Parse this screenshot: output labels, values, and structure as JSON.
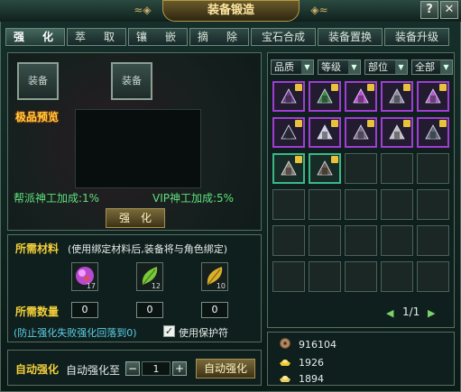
{
  "window": {
    "title": "装备锻造",
    "help_label": "?",
    "close_label": "✕"
  },
  "tabs": [
    {
      "label": "强　化",
      "active": true
    },
    {
      "label": "萃　取",
      "active": false
    },
    {
      "label": "镶　嵌",
      "active": false
    },
    {
      "label": "摘　除",
      "active": false
    },
    {
      "label": "宝石合成",
      "active": false
    },
    {
      "label": "装备置换",
      "active": false
    },
    {
      "label": "装备升级",
      "active": false
    }
  ],
  "enhance": {
    "slot_left_label": "装备",
    "slot_right_label": "装备",
    "preview_label": "极品预览",
    "guild_bonus": "帮派神工加成:1%",
    "vip_bonus": "VIP神工加成:5%",
    "enhance_button": "强　化"
  },
  "materials": {
    "title": "所需材料",
    "hint": "(使用绑定材料后,装备将与角色绑定)",
    "items": [
      {
        "icon": "purple-orb-icon",
        "count": "17",
        "color": "#c04ad8"
      },
      {
        "icon": "green-leaf-icon",
        "count": "12",
        "color": "#7ac83a"
      },
      {
        "icon": "gold-leaf-icon",
        "count": "10",
        "color": "#d8b02a"
      }
    ],
    "quantity_label": "所需数量",
    "quantities": [
      "0",
      "0",
      "0"
    ],
    "protect_hint": "(防止强化失败强化回落到0)",
    "protect_checked": true,
    "protect_label": "使用保护符"
  },
  "auto": {
    "title": "自动强化",
    "target_label": "自动强化至",
    "minus": "−",
    "value": "1",
    "plus": "+",
    "button": "自动强化"
  },
  "filters": [
    {
      "label": "品质"
    },
    {
      "label": "等级"
    },
    {
      "label": "部位"
    },
    {
      "label": "全部"
    }
  ],
  "inventory": {
    "items": [
      {
        "icon": "sword-icon",
        "rarity": "purple"
      },
      {
        "icon": "armor-icon",
        "rarity": "purple"
      },
      {
        "icon": "robe-icon",
        "rarity": "purple"
      },
      {
        "icon": "staff-icon",
        "rarity": "purple"
      },
      {
        "icon": "helmet-icon",
        "rarity": "purple"
      },
      {
        "icon": "bracer-icon",
        "rarity": "purple"
      },
      {
        "icon": "gauntlet-icon",
        "rarity": "purple"
      },
      {
        "icon": "blade-icon",
        "rarity": "purple"
      },
      {
        "icon": "claw-icon",
        "rarity": "purple"
      },
      {
        "icon": "boot-icon",
        "rarity": "purple"
      },
      {
        "icon": "pauldron-icon",
        "rarity": "green"
      },
      {
        "icon": "belt-icon",
        "rarity": "green"
      }
    ],
    "page": "1/1"
  },
  "currency": [
    {
      "icon": "coin-icon",
      "value": "916104"
    },
    {
      "icon": "gold-ingot-icon",
      "value": "1926"
    },
    {
      "icon": "silver-ingot-icon",
      "value": "1894"
    }
  ]
}
